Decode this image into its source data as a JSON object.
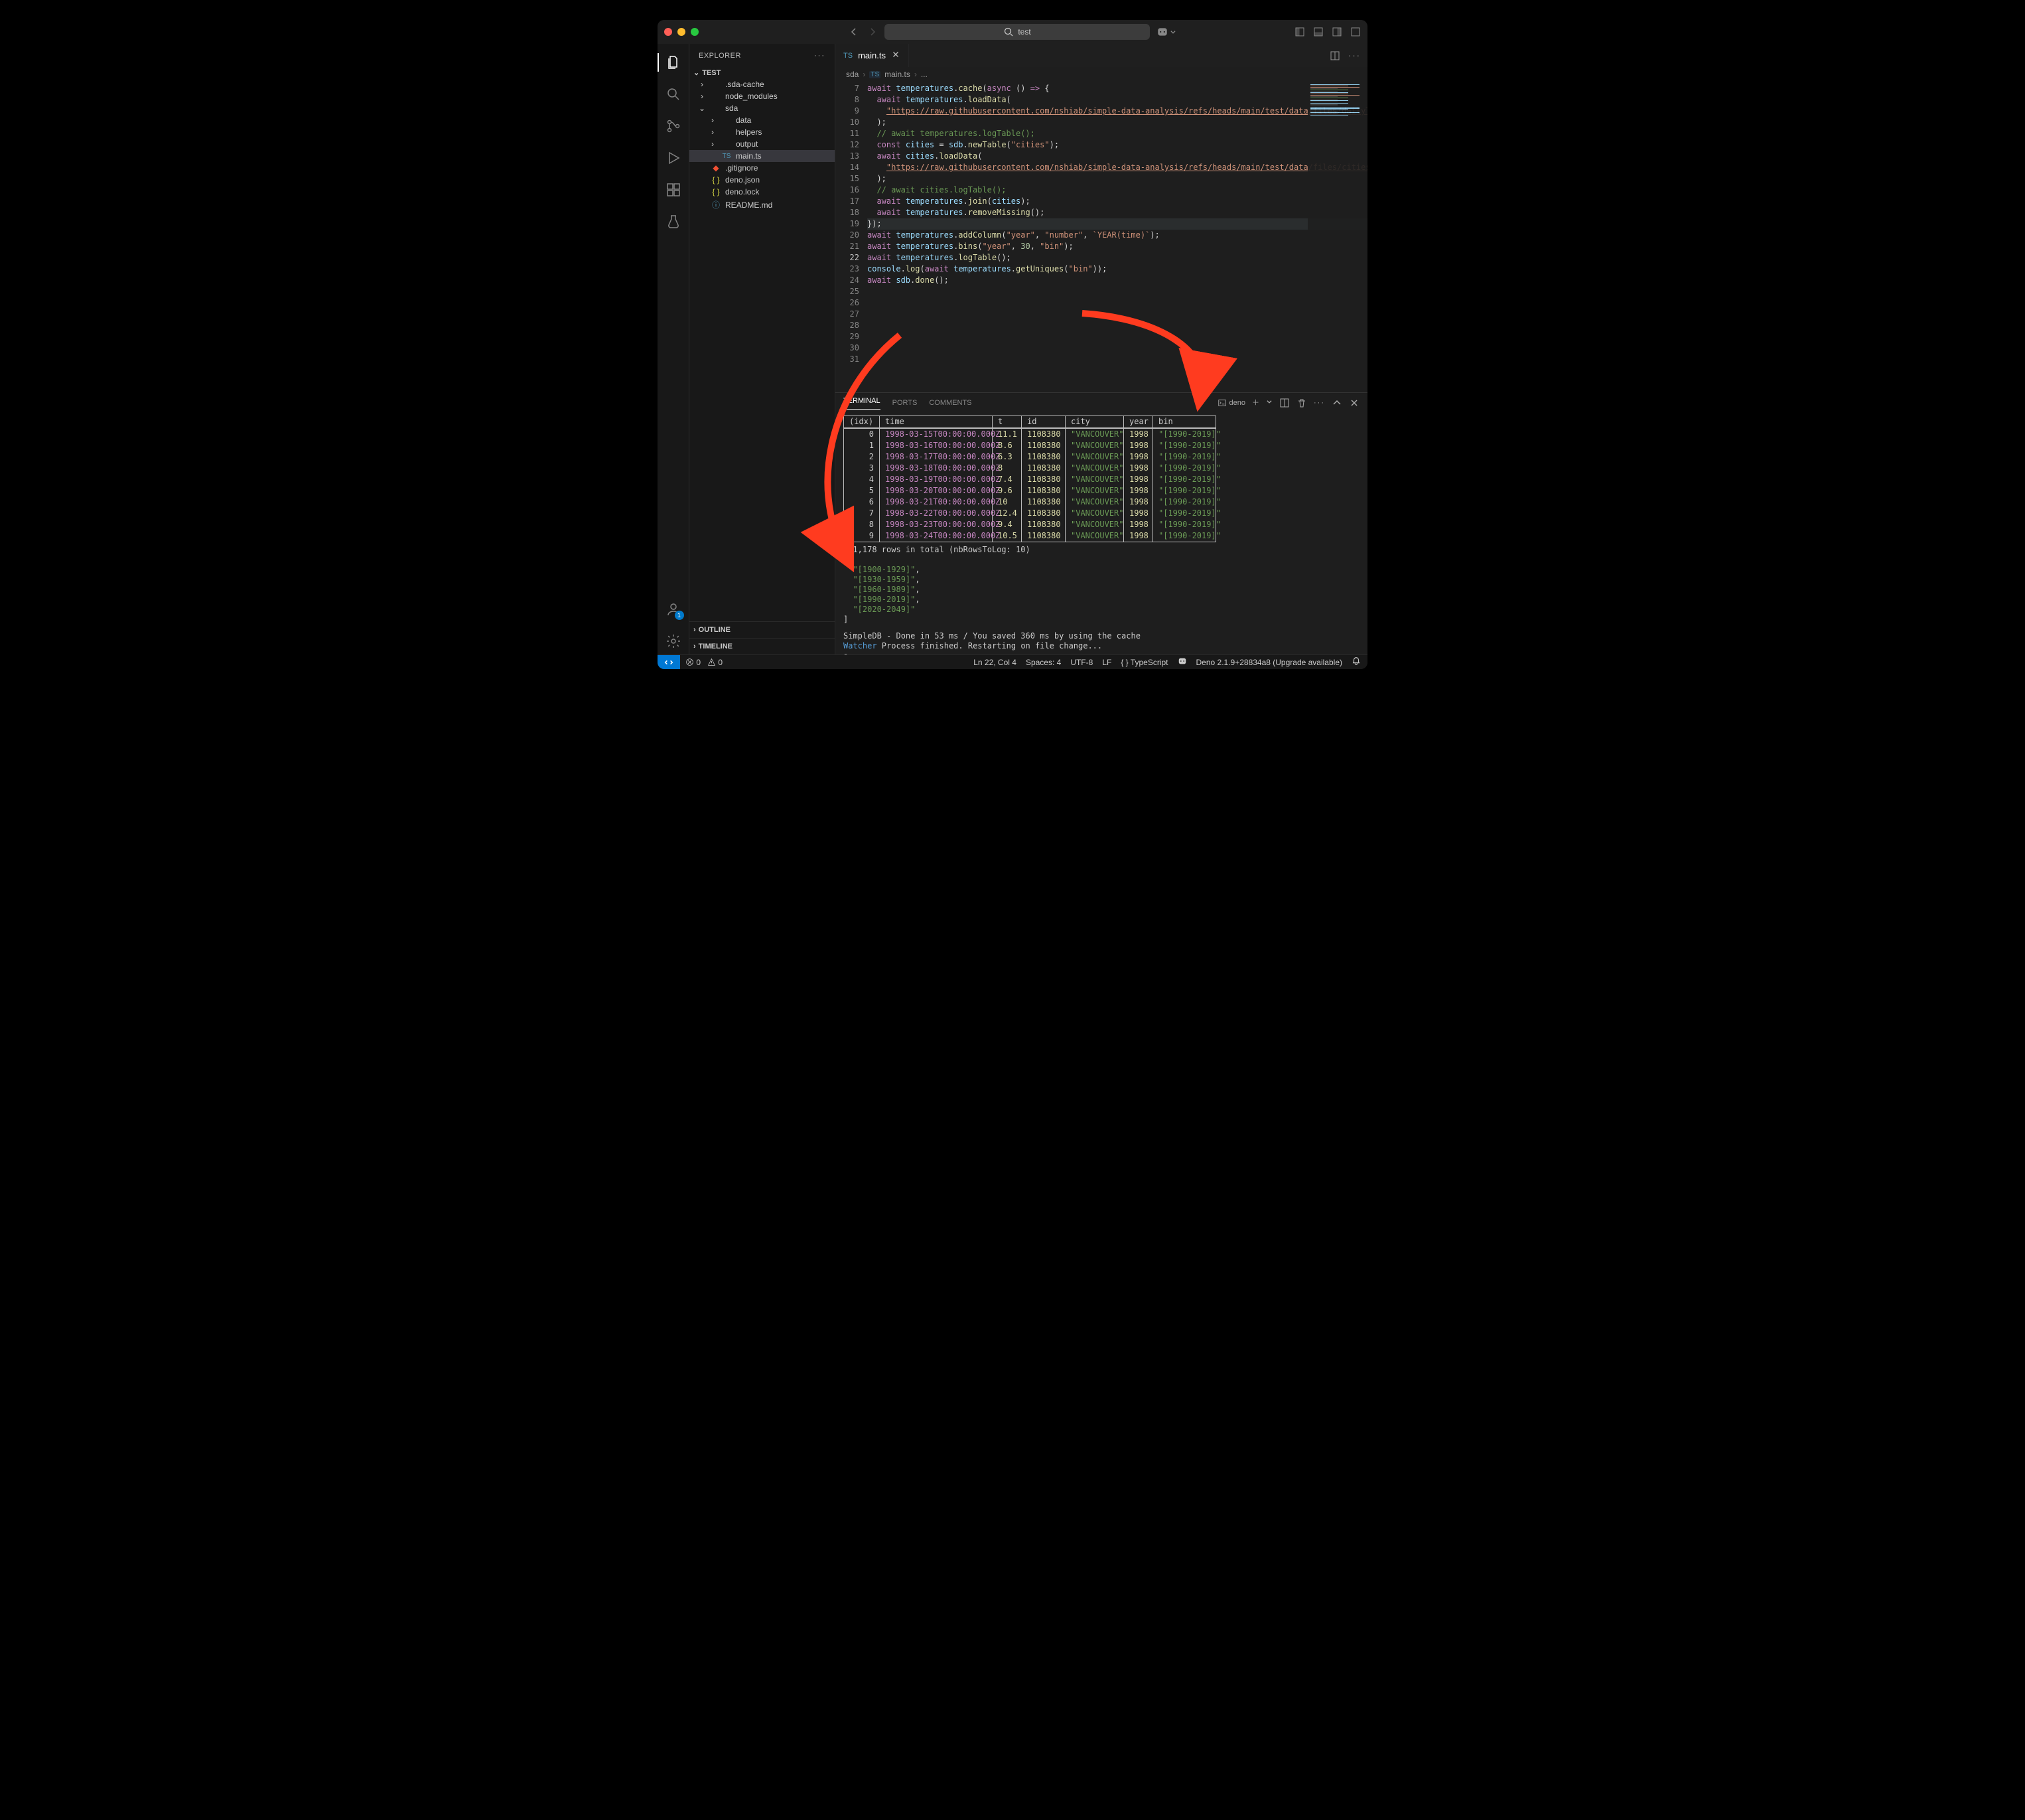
{
  "titlebar": {
    "search_value": "test",
    "search_icon": "search",
    "copilot_icon": "copilot"
  },
  "layout_icons": [
    "layout-primary",
    "layout-panel",
    "layout-secondary",
    "layout-custom"
  ],
  "activity": {
    "items": [
      "files",
      "search",
      "scm",
      "run",
      "extensions",
      "testing"
    ],
    "bottom": [
      "accounts",
      "settings"
    ],
    "accounts_badge": "1"
  },
  "sidebar": {
    "title": "EXPLORER",
    "project": "TEST",
    "tree": [
      {
        "indent": 1,
        "chev": "›",
        "icon": "folder",
        "label": ".sda-cache",
        "kind": "folder"
      },
      {
        "indent": 1,
        "chev": "›",
        "icon": "folder",
        "label": "node_modules",
        "kind": "folder"
      },
      {
        "indent": 1,
        "chev": "⌄",
        "icon": "folder",
        "label": "sda",
        "kind": "folder-open"
      },
      {
        "indent": 2,
        "chev": "›",
        "icon": "folder",
        "label": "data",
        "kind": "folder"
      },
      {
        "indent": 2,
        "chev": "›",
        "icon": "folder",
        "label": "helpers",
        "kind": "folder"
      },
      {
        "indent": 2,
        "chev": "›",
        "icon": "folder",
        "label": "output",
        "kind": "folder"
      },
      {
        "indent": 2,
        "chev": "",
        "icon": "ts",
        "label": "main.ts",
        "kind": "file",
        "selected": true
      },
      {
        "indent": 1,
        "chev": "",
        "icon": "git",
        "label": ".gitignore",
        "kind": "file"
      },
      {
        "indent": 1,
        "chev": "",
        "icon": "json",
        "label": "deno.json",
        "kind": "file"
      },
      {
        "indent": 1,
        "chev": "",
        "icon": "json",
        "label": "deno.lock",
        "kind": "file"
      },
      {
        "indent": 1,
        "chev": "",
        "icon": "md",
        "label": "README.md",
        "kind": "file"
      }
    ],
    "outline": "OUTLINE",
    "timeline": "TIMELINE"
  },
  "tabs": {
    "open": [
      {
        "icon": "TS",
        "label": "main.ts"
      }
    ]
  },
  "breadcrumbs": [
    "sda",
    "main.ts",
    "..."
  ],
  "code": {
    "first_line": 7,
    "active_line": 22,
    "lines": [
      [
        [
          "kw",
          "await "
        ],
        [
          "vr",
          "temperatures"
        ],
        [
          "pn",
          "."
        ],
        [
          "fn",
          "cache"
        ],
        [
          "pn",
          "("
        ],
        [
          "kw",
          "async "
        ],
        [
          "pn",
          "() "
        ],
        [
          "kw",
          "=>"
        ],
        [
          "pn",
          " {"
        ]
      ],
      [
        [
          "pn",
          "  "
        ],
        [
          "kw",
          "await "
        ],
        [
          "vr",
          "temperatures"
        ],
        [
          "pn",
          "."
        ],
        [
          "fn",
          "loadData"
        ],
        [
          "pn",
          "("
        ]
      ],
      [
        [
          "pn",
          "    "
        ],
        [
          "lk",
          "\"https://raw.githubusercontent.com/nshiab/simple-data-analysis/refs/heads/main/test/data/files/dailyTemperatures.csv\""
        ],
        [
          "pn",
          ","
        ]
      ],
      [
        [
          "pn",
          "  );"
        ]
      ],
      [
        [
          "pn",
          "  "
        ],
        [
          "cm",
          "// await temperatures.logTable();"
        ]
      ],
      [
        [
          "pn",
          ""
        ]
      ],
      [
        [
          "pn",
          "  "
        ],
        [
          "kw",
          "const "
        ],
        [
          "vr",
          "cities"
        ],
        [
          "pn",
          " = "
        ],
        [
          "vr",
          "sdb"
        ],
        [
          "pn",
          "."
        ],
        [
          "fn",
          "newTable"
        ],
        [
          "pn",
          "("
        ],
        [
          "st",
          "\"cities\""
        ],
        [
          "pn",
          ");"
        ]
      ],
      [
        [
          "pn",
          "  "
        ],
        [
          "kw",
          "await "
        ],
        [
          "vr",
          "cities"
        ],
        [
          "pn",
          "."
        ],
        [
          "fn",
          "loadData"
        ],
        [
          "pn",
          "("
        ]
      ],
      [
        [
          "pn",
          "    "
        ],
        [
          "lk",
          "\"https://raw.githubusercontent.com/nshiab/simple-data-analysis/refs/heads/main/test/data/files/cities.csv\""
        ],
        [
          "pn",
          ","
        ]
      ],
      [
        [
          "pn",
          "  );"
        ]
      ],
      [
        [
          "pn",
          "  "
        ],
        [
          "cm",
          "// await cities.logTable();"
        ]
      ],
      [
        [
          "pn",
          ""
        ]
      ],
      [
        [
          "pn",
          "  "
        ],
        [
          "kw",
          "await "
        ],
        [
          "vr",
          "temperatures"
        ],
        [
          "pn",
          "."
        ],
        [
          "fn",
          "join"
        ],
        [
          "pn",
          "("
        ],
        [
          "vr",
          "cities"
        ],
        [
          "pn",
          ");"
        ]
      ],
      [
        [
          "pn",
          ""
        ]
      ],
      [
        [
          "pn",
          "  "
        ],
        [
          "kw",
          "await "
        ],
        [
          "vr",
          "temperatures"
        ],
        [
          "pn",
          "."
        ],
        [
          "fn",
          "removeMissing"
        ],
        [
          "pn",
          "();"
        ]
      ],
      [
        [
          "pn",
          "});"
        ]
      ],
      [
        [
          "pn",
          ""
        ]
      ],
      [
        [
          "kw",
          "await "
        ],
        [
          "vr",
          "temperatures"
        ],
        [
          "pn",
          "."
        ],
        [
          "fn",
          "addColumn"
        ],
        [
          "pn",
          "("
        ],
        [
          "st",
          "\"year\""
        ],
        [
          "pn",
          ", "
        ],
        [
          "st",
          "\"number\""
        ],
        [
          "pn",
          ", "
        ],
        [
          "tpl",
          "`YEAR(time)`"
        ],
        [
          "pn",
          ");"
        ]
      ],
      [
        [
          "kw",
          "await "
        ],
        [
          "vr",
          "temperatures"
        ],
        [
          "pn",
          "."
        ],
        [
          "fn",
          "bins"
        ],
        [
          "pn",
          "("
        ],
        [
          "st",
          "\"year\""
        ],
        [
          "pn",
          ", "
        ],
        [
          "nm",
          "30"
        ],
        [
          "pn",
          ", "
        ],
        [
          "st",
          "\"bin\""
        ],
        [
          "pn",
          ");"
        ]
      ],
      [
        [
          "kw",
          "await "
        ],
        [
          "vr",
          "temperatures"
        ],
        [
          "pn",
          "."
        ],
        [
          "fn",
          "logTable"
        ],
        [
          "pn",
          "();"
        ]
      ],
      [
        [
          "pn",
          ""
        ]
      ],
      [
        [
          "vr",
          "console"
        ],
        [
          "pn",
          "."
        ],
        [
          "fn",
          "log"
        ],
        [
          "pn",
          "("
        ],
        [
          "kw",
          "await "
        ],
        [
          "vr",
          "temperatures"
        ],
        [
          "pn",
          "."
        ],
        [
          "fn",
          "getUniques"
        ],
        [
          "pn",
          "("
        ],
        [
          "st",
          "\"bin\""
        ],
        [
          "pn",
          "));"
        ]
      ],
      [
        [
          "pn",
          ""
        ]
      ],
      [
        [
          "kw",
          "await "
        ],
        [
          "vr",
          "sdb"
        ],
        [
          "pn",
          "."
        ],
        [
          "fn",
          "done"
        ],
        [
          "pn",
          "();"
        ]
      ],
      [
        [
          "pn",
          ""
        ]
      ]
    ]
  },
  "panel": {
    "tabs": [
      "TERMINAL",
      "PORTS",
      "COMMENTS"
    ],
    "active_tab": 0,
    "term_label": "deno",
    "table": {
      "headers": [
        "(idx)",
        "time",
        "t",
        "id",
        "city",
        "year",
        "bin"
      ],
      "rows": [
        [
          "0",
          "1998-03-15T00:00:00.000Z",
          "11.1",
          "1108380",
          "\"VANCOUVER\"",
          "1998",
          "\"[1990-2019]\""
        ],
        [
          "1",
          "1998-03-16T00:00:00.000Z",
          "8.6",
          "1108380",
          "\"VANCOUVER\"",
          "1998",
          "\"[1990-2019]\""
        ],
        [
          "2",
          "1998-03-17T00:00:00.000Z",
          "6.3",
          "1108380",
          "\"VANCOUVER\"",
          "1998",
          "\"[1990-2019]\""
        ],
        [
          "3",
          "1998-03-18T00:00:00.000Z",
          "8",
          "1108380",
          "\"VANCOUVER\"",
          "1998",
          "\"[1990-2019]\""
        ],
        [
          "4",
          "1998-03-19T00:00:00.000Z",
          "7.4",
          "1108380",
          "\"VANCOUVER\"",
          "1998",
          "\"[1990-2019]\""
        ],
        [
          "5",
          "1998-03-20T00:00:00.000Z",
          "9.6",
          "1108380",
          "\"VANCOUVER\"",
          "1998",
          "\"[1990-2019]\""
        ],
        [
          "6",
          "1998-03-21T00:00:00.000Z",
          "10",
          "1108380",
          "\"VANCOUVER\"",
          "1998",
          "\"[1990-2019]\""
        ],
        [
          "7",
          "1998-03-22T00:00:00.000Z",
          "12.4",
          "1108380",
          "\"VANCOUVER\"",
          "1998",
          "\"[1990-2019]\""
        ],
        [
          "8",
          "1998-03-23T00:00:00.000Z",
          "9.4",
          "1108380",
          "\"VANCOUVER\"",
          "1998",
          "\"[1990-2019]\""
        ],
        [
          "9",
          "1998-03-24T00:00:00.000Z",
          "10.5",
          "1108380",
          "\"VANCOUVER\"",
          "1998",
          "\"[1990-2019]\""
        ]
      ]
    },
    "totals": "131,178 rows in total (nbRowsToLog: 10)",
    "uniques": [
      "\"[1900-1929]\"",
      "\"[1930-1959]\"",
      "\"[1960-1989]\"",
      "\"[1990-2019]\"",
      "\"[2020-2049]\""
    ],
    "done": "SimpleDB - Done in 53 ms / You saved 360 ms by using the cache",
    "watcher_label": "Watcher",
    "watcher_rest": " Process finished. Restarting on file change...",
    "prompt": "[]"
  },
  "status": {
    "errors": "0",
    "warnings": "0",
    "ln_col": "Ln 22, Col 4",
    "spaces": "Spaces: 4",
    "encoding": "UTF-8",
    "eol": "LF",
    "lang": "TypeScript",
    "deno": "Deno 2.1.9+28834a8 (Upgrade available)"
  }
}
